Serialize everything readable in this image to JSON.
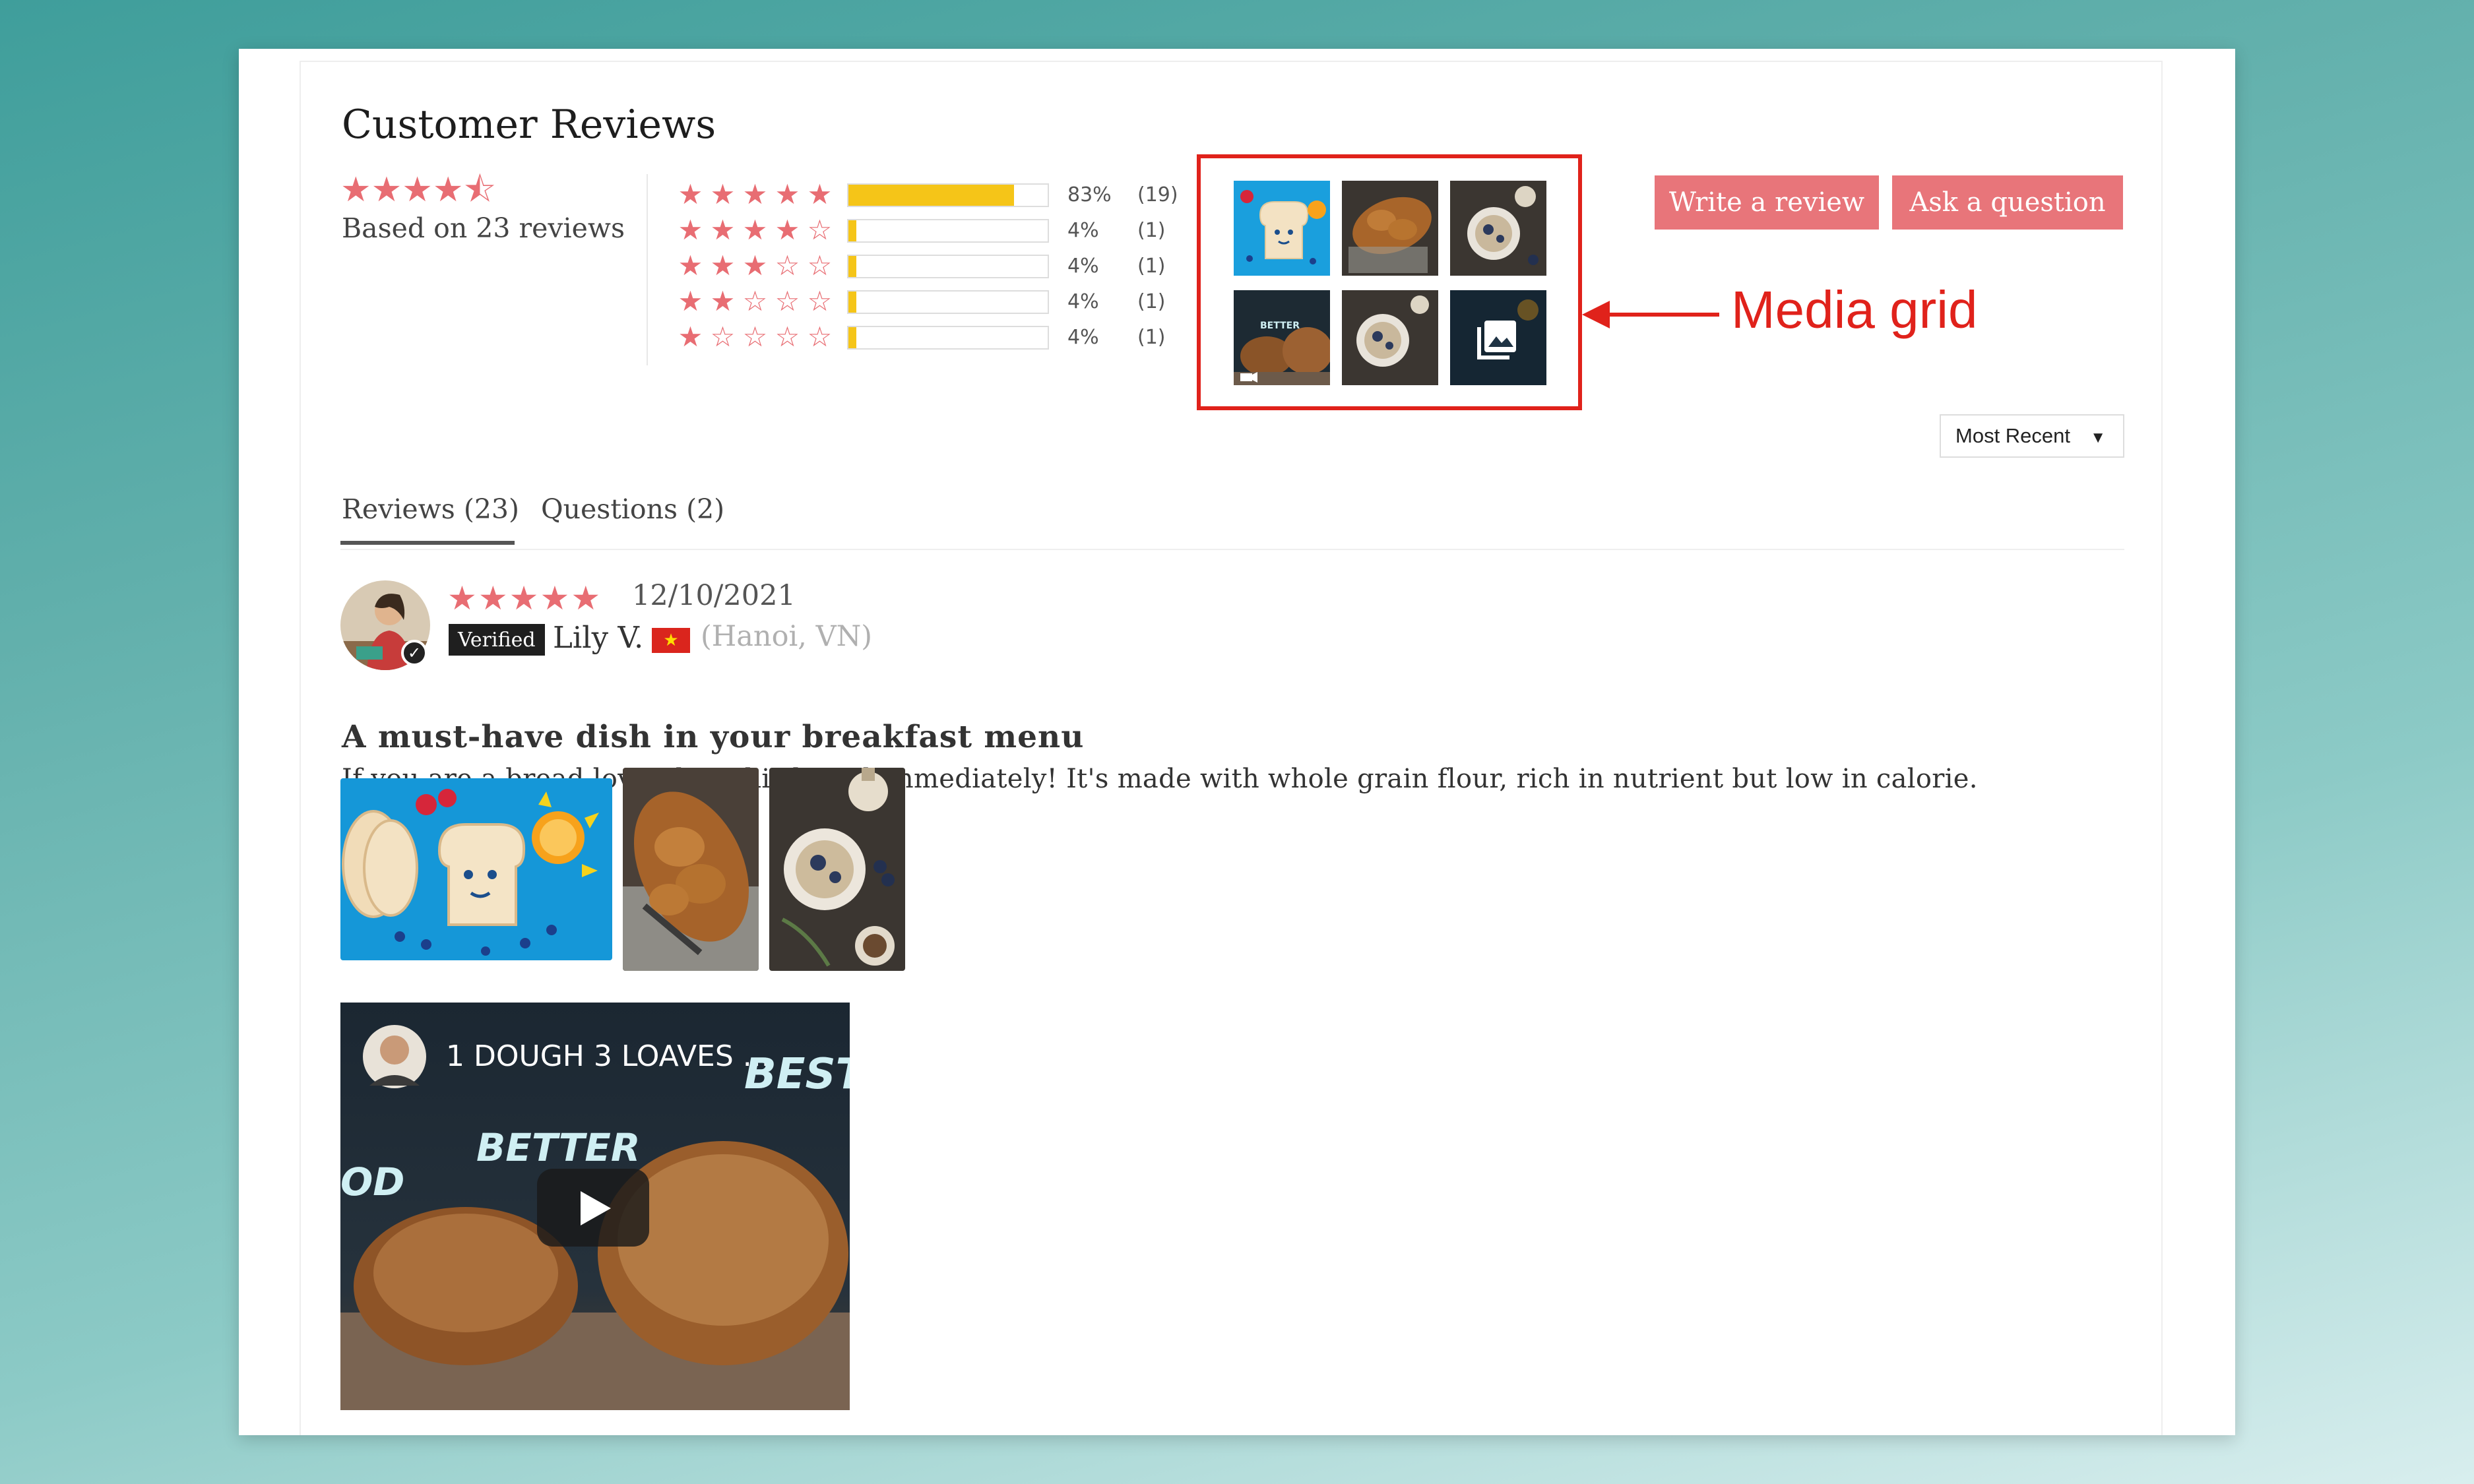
{
  "reviews_header": {
    "title": "Customer Reviews",
    "average_rating": 4.5,
    "based_on": "Based on 23 reviews"
  },
  "distribution": [
    {
      "stars": 5,
      "percent_text": "83%",
      "count_text": "(19)",
      "fill": 0.83
    },
    {
      "stars": 4,
      "percent_text": "4%",
      "count_text": "(1)",
      "fill": 0.04
    },
    {
      "stars": 3,
      "percent_text": "4%",
      "count_text": "(1)",
      "fill": 0.04
    },
    {
      "stars": 2,
      "percent_text": "4%",
      "count_text": "(1)",
      "fill": 0.04
    },
    {
      "stars": 1,
      "percent_text": "4%",
      "count_text": "(1)",
      "fill": 0.04
    }
  ],
  "actions": {
    "write_review": "Write a review",
    "ask_question": "Ask a question"
  },
  "annotation": {
    "label": "Media grid"
  },
  "sort": {
    "selected": "Most Recent"
  },
  "tabs": [
    {
      "label": "Reviews (23)",
      "active": true
    },
    {
      "label": "Questions (2)",
      "active": false
    }
  ],
  "review": {
    "rating": 5,
    "date": "12/10/2021",
    "verified_label": "Verified",
    "author": "Lily V.",
    "location": "(Hanoi, VN)",
    "title": "A must-have dish in your breakfast menu",
    "body": "If you are a bread lover, buy this bread immediately! It's made with whole grain flour, rich in nutrient but low in calorie."
  },
  "video": {
    "title": "1 DOUGH 3 LOAVES ...",
    "overlay_word_1": "BEST",
    "overlay_word_2": "BETTER",
    "overlay_word_3": "OD"
  },
  "colors": {
    "accent": "#e8757a",
    "star": "#e86d73",
    "bar_fill": "#f5c518",
    "annotation": "#e0221b"
  }
}
